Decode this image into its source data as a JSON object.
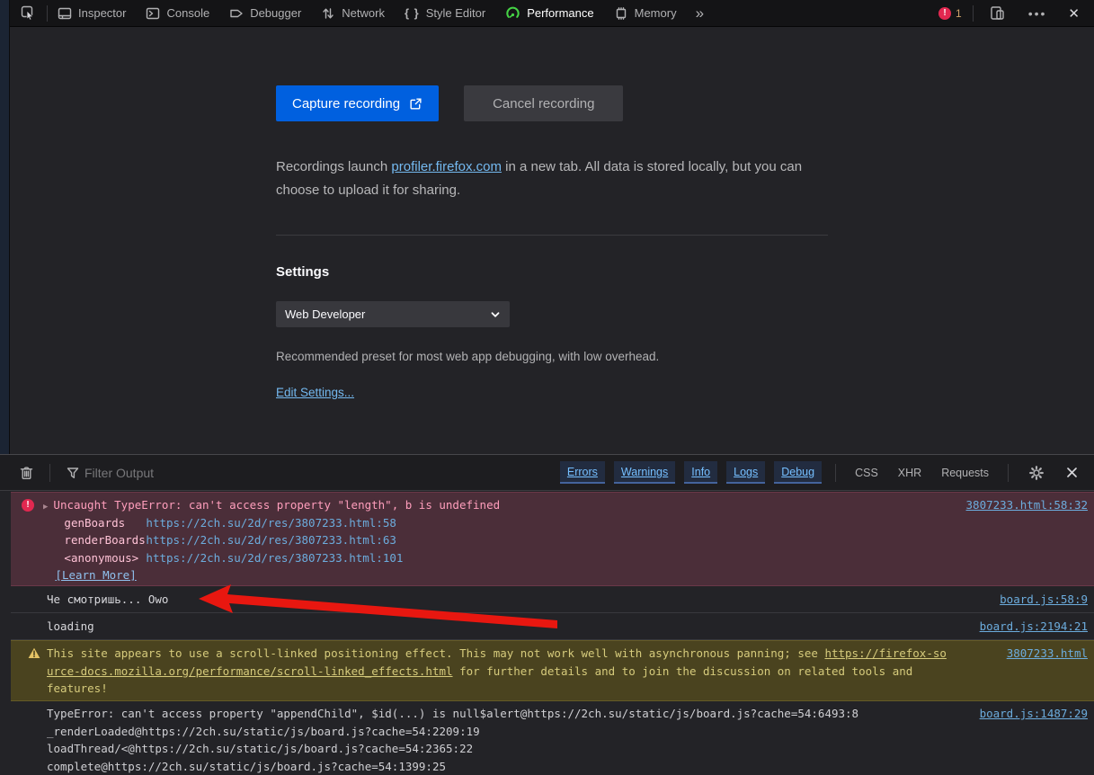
{
  "colors": {
    "accent_blue": "#0060df",
    "link_blue": "#75bfff",
    "error_red": "#e22850",
    "warning_yellow": "#e5c465",
    "annotation_arrow_red": "#e81710"
  },
  "toolbar": {
    "tabs": [
      {
        "label": "Inspector"
      },
      {
        "label": "Console"
      },
      {
        "label": "Debugger"
      },
      {
        "label": "Network"
      },
      {
        "label": "Style Editor"
      },
      {
        "label": "Performance"
      },
      {
        "label": "Memory"
      }
    ],
    "active_tab": "Performance",
    "overflow_chevron": "»",
    "error_badge": {
      "glyph": "!",
      "count": "1"
    },
    "meatball_menu": "•••",
    "close": "✕",
    "style_editor_glyph": "{ }"
  },
  "performance_panel": {
    "capture_button": "Capture recording",
    "cancel_button": "Cancel recording",
    "note_pre": "Recordings launch ",
    "note_link": "profiler.firefox.com",
    "note_post": " in a new tab. All data is stored locally, but you can choose to upload it for sharing.",
    "settings_heading": "Settings",
    "preset_value": "Web Developer",
    "preset_description": "Recommended preset for most web app debugging, with low overhead.",
    "edit_settings_link": "Edit Settings..."
  },
  "console": {
    "filter_placeholder": "Filter Output",
    "level_filters": [
      "Errors",
      "Warnings",
      "Info",
      "Logs",
      "Debug"
    ],
    "type_filters": [
      "CSS",
      "XHR",
      "Requests"
    ],
    "messages": {
      "error1": {
        "expand_glyph": "▶",
        "icon_glyph": "!",
        "text": "Uncaught TypeError: can't access property \"length\", b is undefined",
        "frames": [
          {
            "fn": "genBoards",
            "loc": "https://2ch.su/2d/res/3807233.html:58"
          },
          {
            "fn": "renderBoards",
            "loc": "https://2ch.su/2d/res/3807233.html:63"
          },
          {
            "fn": "<anonymous>",
            "loc": "https://2ch.su/2d/res/3807233.html:101"
          }
        ],
        "learn_more": "[Learn More]",
        "source": "3807233.html:58:32"
      },
      "log1": {
        "text": "Че смотришь... Owo",
        "source": "board.js:58:9"
      },
      "log2": {
        "text": "loading",
        "source": "board.js:2194:21"
      },
      "warning1": {
        "icon_glyph": "!",
        "pre": "This site appears to use a scroll-linked positioning effect. This may not work well with asynchronous panning; see ",
        "link": "https://firefox-source-docs.mozilla.org/performance/scroll-linked_effects.html",
        "post": " for further details and to join the discussion on related tools and features!",
        "source": "3807233.html"
      },
      "stacklog1": {
        "line1": "TypeError: can't access property \"appendChild\", $id(...) is null$alert@https://2ch.su/static/js/board.js?cache=54:6493:8",
        "line2": "_renderLoaded@https://2ch.su/static/js/board.js?cache=54:2209:19",
        "line3": "loadThread/<@https://2ch.su/static/js/board.js?cache=54:2365:22",
        "line4": "complete@https://2ch.su/static/js/board.js?cache=54:1399:25",
        "source": "board.js:1487:29"
      }
    }
  }
}
